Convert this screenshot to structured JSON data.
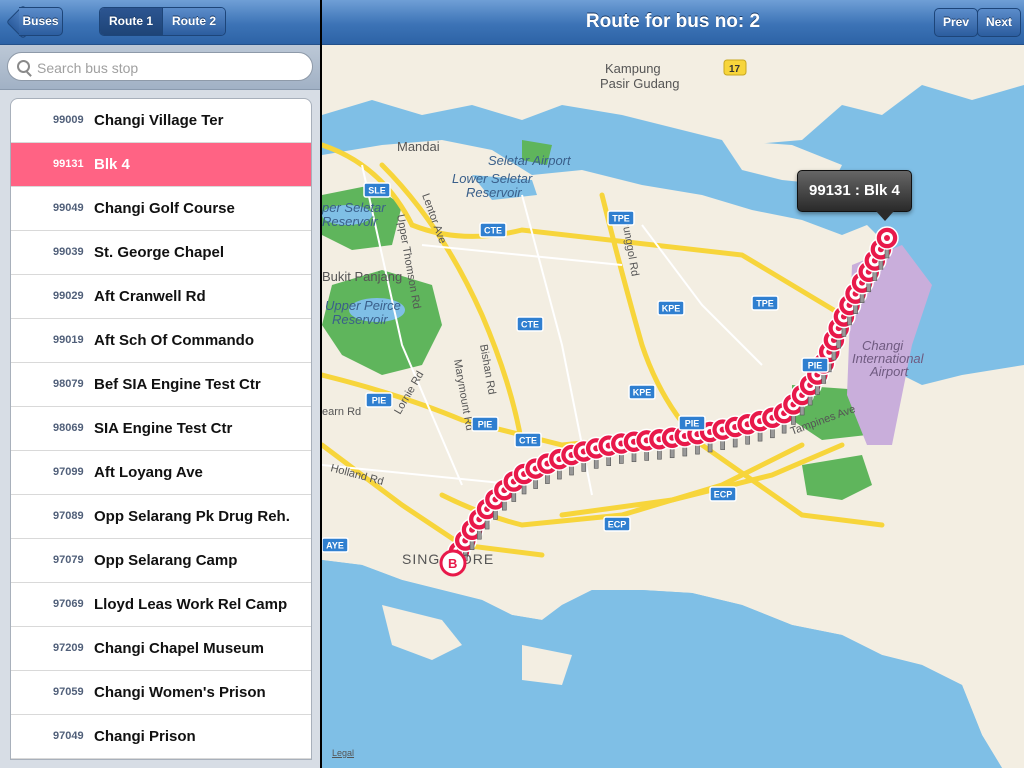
{
  "left": {
    "back_label": "Buses",
    "segments": [
      {
        "label": "Route 1",
        "active": true
      },
      {
        "label": "Route 2",
        "active": false
      }
    ],
    "search_placeholder": "Search bus stop",
    "stops": [
      {
        "code": "99009",
        "name": "Changi Village Ter"
      },
      {
        "code": "99131",
        "name": "Blk 4",
        "selected": true
      },
      {
        "code": "99049",
        "name": "Changi Golf Course"
      },
      {
        "code": "99039",
        "name": "St. George Chapel"
      },
      {
        "code": "99029",
        "name": "Aft Cranwell Rd"
      },
      {
        "code": "99019",
        "name": "Aft Sch Of Commando"
      },
      {
        "code": "98079",
        "name": "Bef SIA Engine Test Ctr"
      },
      {
        "code": "98069",
        "name": "SIA Engine Test Ctr"
      },
      {
        "code": "97099",
        "name": "Aft Loyang Ave"
      },
      {
        "code": "97089",
        "name": "Opp Selarang Pk Drug Reh."
      },
      {
        "code": "97079",
        "name": "Opp Selarang Camp"
      },
      {
        "code": "97069",
        "name": "Lloyd Leas Work Rel Camp"
      },
      {
        "code": "97209",
        "name": "Changi Chapel Museum"
      },
      {
        "code": "97059",
        "name": "Changi Women's Prison"
      },
      {
        "code": "97049",
        "name": "Changi Prison"
      }
    ]
  },
  "right": {
    "title": "Route for bus no: 2",
    "prev_label": "Prev",
    "next_label": "Next",
    "callout": "99131 : Blk 4",
    "legal": "Legal",
    "map_labels": {
      "kampung": "Kampung",
      "pasir_gudang": "Pasir Gudang",
      "road17": "17",
      "mandai": "Mandai",
      "seletar_airport": "Seletar Airport",
      "lower_seletar_1": "Lower Seletar",
      "lower_seletar_2": "Reservoir",
      "upper_seletar_1": "per Seletar",
      "upper_seletar_2": "Reservoir",
      "bukit_panjang": "Bukit Panjang",
      "upper_peirce_1": "Upper Peirce",
      "upper_peirce_2": "Reservoir",
      "changi_1": "Changi",
      "changi_2": "International",
      "changi_3": "Airport",
      "singapore": "SINGAPORE",
      "holland": "Holland Rd",
      "lentor": "Lentor Ave",
      "upper_thomson": "Upper Thomson Rd",
      "punggol": "Punggol Rd",
      "marymount": "Marymount Rd",
      "bishan": "Bishan Rd",
      "lornie": "Lornie Rd",
      "dunearn": "earn Rd",
      "tampines": "Tampines Ave",
      "loyang": "Ave",
      "b_marker": "B"
    },
    "expressways": [
      "SLE",
      "CTE",
      "TPE",
      "KPE",
      "TPE",
      "CTE",
      "PIE",
      "KPE",
      "PIE",
      "PIE",
      "CTE",
      "ECP",
      "ECP",
      "PIE",
      "AYE"
    ]
  },
  "colors": {
    "water": "#7fbfe6",
    "land": "#f3eee2",
    "park": "#5fb55c",
    "airport": "#c9aedb",
    "expressway": "#f7d53b",
    "marker": "#e8194a",
    "selected_row": "#ff6384",
    "navbar": "#3c73b6"
  }
}
